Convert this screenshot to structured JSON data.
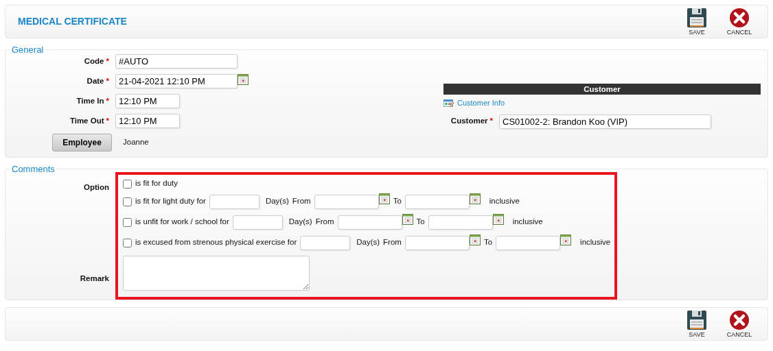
{
  "header": {
    "title": "MEDICAL CERTIFICATE",
    "actions": [
      {
        "kind": "save",
        "label": "SAVE"
      },
      {
        "kind": "cancel",
        "label": "CANCEL"
      }
    ]
  },
  "general": {
    "legend": "General",
    "fields": [
      {
        "kind": "text",
        "label": "Code",
        "required_mark": "*",
        "value": "#AUTO"
      },
      {
        "kind": "datetime",
        "label": "Date",
        "required_mark": "*",
        "value": "21-04-2021 12:10 PM"
      },
      {
        "kind": "time",
        "label": "Time In",
        "required_mark": "*",
        "value": "12:10 PM"
      },
      {
        "kind": "time",
        "label": "Time Out",
        "required_mark": "*",
        "value": "12:10 PM"
      }
    ],
    "employee": {
      "button": "Employee",
      "value": "Joanne"
    },
    "customer": {
      "heading": "Customer",
      "info_link": "Customer Info",
      "label": "Customer",
      "required_mark": "*",
      "value": "CS01002-2: Brandon Koo (VIP)"
    }
  },
  "comments": {
    "legend": "Comments",
    "option_label": "Option",
    "highlighted": true,
    "options": [
      {
        "kind": "plain",
        "checked": false,
        "text": "is fit for duty"
      },
      {
        "kind": "period",
        "checked": false,
        "text": "is fit for light duty for",
        "days_label": "Day(s)",
        "from_label": "From",
        "to_label": "To",
        "suffix": "inclusive"
      },
      {
        "kind": "period",
        "checked": false,
        "text": "is unfit for work / school for",
        "days_label": "Day(s)",
        "from_label": "From",
        "to_label": "To",
        "suffix": "inclusive"
      },
      {
        "kind": "period",
        "checked": false,
        "text": "is excused from strenous physical exercise for",
        "days_label": "Day(s)",
        "from_label": "From",
        "to_label": "To",
        "suffix": "inclusive"
      }
    ],
    "remark_label": "Remark"
  },
  "footer": {
    "actions": [
      {
        "kind": "save",
        "label": "SAVE"
      },
      {
        "kind": "cancel",
        "label": "CANCEL"
      }
    ]
  }
}
